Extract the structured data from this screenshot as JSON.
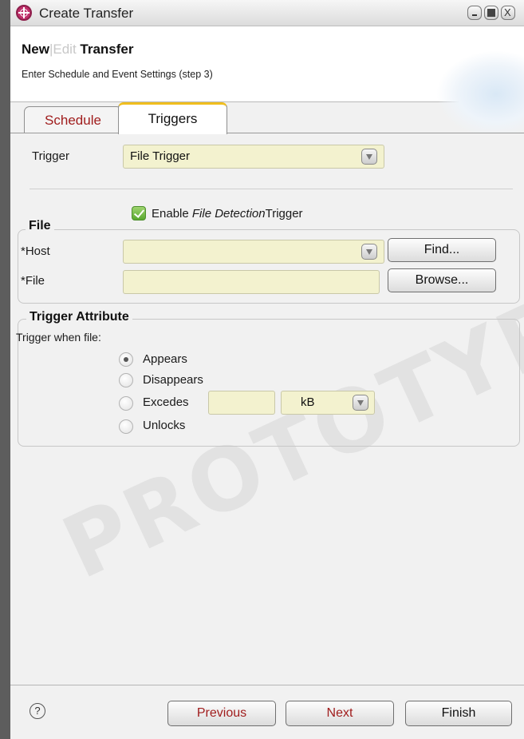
{
  "window": {
    "title": "Create Transfer"
  },
  "header": {
    "title_new": "New",
    "title_sep": "|",
    "title_edit": "Edit",
    "title_rest": " Transfer",
    "subtitle": "Enter Schedule and Event Settings (step 3)"
  },
  "tabs": [
    {
      "label": "Schedule"
    },
    {
      "label": "Triggers"
    }
  ],
  "trigger": {
    "label": "Trigger",
    "value": "File Trigger"
  },
  "enable": {
    "prefix": "Enable ",
    "italic": "File Detection",
    "suffix": "Trigger",
    "checked": true
  },
  "file_section": {
    "legend": "File",
    "host_label": "*Host",
    "host_value": "",
    "find_label": "Find...",
    "file_label": "*File",
    "file_value": "",
    "browse_label": "Browse..."
  },
  "trigger_attr": {
    "legend": "Trigger Attribute",
    "when_label": "Trigger when file:",
    "options": [
      {
        "label": "Appears",
        "selected": true
      },
      {
        "label": "Disappears",
        "selected": false
      },
      {
        "label": "Excedes",
        "selected": false
      },
      {
        "label": "Unlocks",
        "selected": false
      }
    ],
    "size_value": "",
    "unit_value": "kB"
  },
  "watermark": "PROTOTYPE",
  "footer": {
    "help_symbol": "?",
    "previous": "Previous",
    "next": "Next",
    "finish": "Finish"
  },
  "colors": {
    "accent_red": "#a01d1d",
    "field_bg": "#f3f2cf",
    "tab_highlight": "#f0be1e",
    "check_green": "#59a82f"
  },
  "icons": [
    "app-icon",
    "minimize-icon",
    "maximize-icon",
    "close-icon",
    "dropdown-icon",
    "checkmark-icon",
    "help-icon"
  ]
}
